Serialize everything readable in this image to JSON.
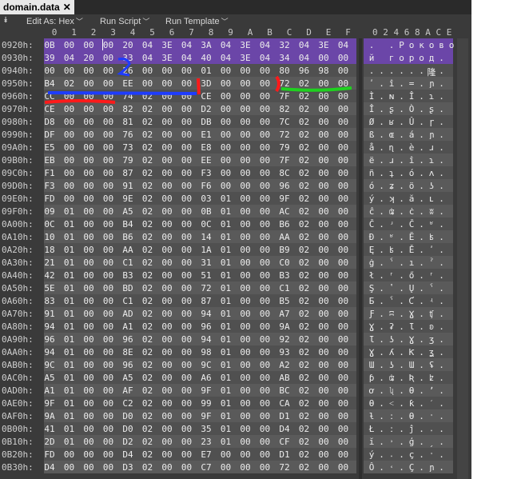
{
  "tab": {
    "title": "domain.data",
    "close": "✕"
  },
  "toolbar": {
    "edit_as": "Edit As: Hex",
    "run_script": "Run Script",
    "run_template": "Run Template"
  },
  "header": {
    "cols": [
      "0",
      "1",
      "2",
      "3",
      "4",
      "5",
      "6",
      "7",
      "8",
      "9",
      "A",
      "B",
      "C",
      "D",
      "E",
      "F"
    ],
    "ascii_cols": "0 2 4 6 8 A C E"
  },
  "rows": [
    {
      "addr": "0920h:",
      "bytes": [
        "0B",
        "00",
        "00",
        "00",
        "20",
        "04",
        "3E",
        "04",
        "3A",
        "04",
        "3E",
        "04",
        "32",
        "04",
        "3E",
        "04"
      ],
      "ascii": [
        ".",
        " ",
        ".",
        "Р",
        "о",
        "к",
        "о",
        "в",
        "о"
      ]
    },
    {
      "addr": "0930h:",
      "bytes": [
        "39",
        "04",
        "20",
        "00",
        "33",
        "04",
        "3E",
        "04",
        "40",
        "04",
        "3E",
        "04",
        "34",
        "04",
        "00",
        "00"
      ],
      "ascii": [
        "й",
        " ",
        "г",
        "о",
        "р",
        "о",
        "д",
        "."
      ]
    },
    {
      "addr": "0940h:",
      "bytes": [
        "00",
        "00",
        "00",
        "00",
        "26",
        "00",
        "00",
        "00",
        "01",
        "00",
        "00",
        "00",
        "80",
        "96",
        "98",
        "00"
      ],
      "ascii": [
        ".",
        ".",
        ".",
        ".",
        ".",
        ".",
        "隆",
        "."
      ]
    },
    {
      "addr": "0950h:",
      "bytes": [
        "B4",
        "02",
        "00",
        "00",
        "EE",
        "00",
        "00",
        "00",
        "3D",
        "00",
        "00",
        "00",
        "72",
        "02",
        "00",
        "00"
      ],
      "ascii": [
        "ʹ",
        ".",
        "î",
        ".",
        "=",
        ".",
        "ɲ",
        "."
      ]
    },
    {
      "addr": "0960h:",
      "bytes": [
        "CC",
        "00",
        "00",
        "00",
        "74",
        "02",
        "00",
        "00",
        "CE",
        "00",
        "00",
        "00",
        "7F",
        "02",
        "00",
        "00"
      ],
      "ascii": [
        "Ì",
        ".",
        "ɴ",
        ".",
        "Î",
        ".",
        "ɿ",
        "."
      ]
    },
    {
      "addr": "0970h:",
      "bytes": [
        "CE",
        "00",
        "00",
        "00",
        "82",
        "02",
        "00",
        "00",
        "D2",
        "00",
        "00",
        "00",
        "82",
        "02",
        "00",
        "00"
      ],
      "ascii": [
        "Î",
        ".",
        "ʂ",
        ".",
        "Ò",
        ".",
        "ʂ",
        "."
      ]
    },
    {
      "addr": "0980h:",
      "bytes": [
        "D8",
        "00",
        "00",
        "00",
        "81",
        "02",
        "00",
        "00",
        "DB",
        "00",
        "00",
        "00",
        "7C",
        "02",
        "00",
        "00"
      ],
      "ascii": [
        "Ø",
        ".",
        "ʁ",
        ".",
        "Û",
        ".",
        "ɼ",
        "."
      ]
    },
    {
      "addr": "0990h:",
      "bytes": [
        "DF",
        "00",
        "00",
        "00",
        "76",
        "02",
        "00",
        "00",
        "E1",
        "00",
        "00",
        "00",
        "72",
        "02",
        "00",
        "00"
      ],
      "ascii": [
        "ß",
        ".",
        "ɶ",
        ".",
        "á",
        ".",
        "ɲ",
        "."
      ]
    },
    {
      "addr": "09A0h:",
      "bytes": [
        "E5",
        "00",
        "00",
        "00",
        "73",
        "02",
        "00",
        "00",
        "E8",
        "00",
        "00",
        "00",
        "79",
        "02",
        "00",
        "00"
      ],
      "ascii": [
        "å",
        ".",
        "ɳ",
        ".",
        "è",
        ".",
        "ɹ",
        "."
      ]
    },
    {
      "addr": "09B0h:",
      "bytes": [
        "EB",
        "00",
        "00",
        "00",
        "79",
        "02",
        "00",
        "00",
        "EE",
        "00",
        "00",
        "00",
        "7F",
        "02",
        "00",
        "00"
      ],
      "ascii": [
        "ë",
        ".",
        "ɹ",
        ".",
        "î",
        ".",
        "ɿ",
        "."
      ]
    },
    {
      "addr": "09C0h:",
      "bytes": [
        "F1",
        "00",
        "00",
        "00",
        "87",
        "02",
        "00",
        "00",
        "F3",
        "00",
        "00",
        "00",
        "8C",
        "02",
        "00",
        "00"
      ],
      "ascii": [
        "ñ",
        ".",
        "ʇ",
        ".",
        "ó",
        ".",
        "ʌ",
        "."
      ]
    },
    {
      "addr": "09D0h:",
      "bytes": [
        "F3",
        "00",
        "00",
        "00",
        "91",
        "02",
        "00",
        "00",
        "F6",
        "00",
        "00",
        "00",
        "96",
        "02",
        "00",
        "00"
      ],
      "ascii": [
        "ó",
        ".",
        "ʑ",
        ".",
        "ö",
        ".",
        "ʖ",
        "."
      ]
    },
    {
      "addr": "09E0h:",
      "bytes": [
        "FD",
        "00",
        "00",
        "00",
        "9E",
        "02",
        "00",
        "00",
        "03",
        "01",
        "00",
        "00",
        "9F",
        "02",
        "00",
        "00"
      ],
      "ascii": [
        "ý",
        ".",
        "ʞ",
        ".",
        "ă",
        ".",
        "ʟ",
        "."
      ]
    },
    {
      "addr": "09F0h:",
      "bytes": [
        "09",
        "01",
        "00",
        "00",
        "A5",
        "02",
        "00",
        "00",
        "0B",
        "01",
        "00",
        "00",
        "AC",
        "02",
        "00",
        "00"
      ],
      "ascii": [
        "ĉ",
        ".",
        "ʥ",
        ".",
        "ċ",
        ".",
        "ʬ",
        "."
      ]
    },
    {
      "addr": "0A00h:",
      "bytes": [
        "0C",
        "01",
        "00",
        "00",
        "B4",
        "02",
        "00",
        "00",
        "0C",
        "01",
        "00",
        "00",
        "B6",
        "02",
        "00",
        "00"
      ],
      "ascii": [
        "Č",
        ".",
        "ʴ",
        ".",
        "Č",
        ".",
        "ʶ",
        "."
      ]
    },
    {
      "addr": "0A10h:",
      "bytes": [
        "10",
        "01",
        "00",
        "00",
        "B6",
        "02",
        "00",
        "00",
        "14",
        "01",
        "00",
        "00",
        "AA",
        "02",
        "00",
        "00"
      ],
      "ascii": [
        "Đ",
        ".",
        "ʶ",
        ".",
        "Ĕ",
        ".",
        "ʪ",
        "."
      ]
    },
    {
      "addr": "0A20h:",
      "bytes": [
        "18",
        "01",
        "00",
        "00",
        "AA",
        "02",
        "00",
        "00",
        "1A",
        "01",
        "00",
        "00",
        "B9",
        "02",
        "00",
        "00"
      ],
      "ascii": [
        "Ę",
        ".",
        "ʪ",
        ".",
        "Ě",
        ".",
        "ʹ",
        "."
      ]
    },
    {
      "addr": "0A30h:",
      "bytes": [
        "21",
        "01",
        "00",
        "00",
        "C1",
        "02",
        "00",
        "00",
        "31",
        "01",
        "00",
        "00",
        "C0",
        "02",
        "00",
        "00"
      ],
      "ascii": [
        "ġ",
        ".",
        "ˁ",
        ".",
        "ı",
        ".",
        "ˀ",
        "."
      ]
    },
    {
      "addr": "0A40h:",
      "bytes": [
        "42",
        "01",
        "00",
        "00",
        "B3",
        "02",
        "00",
        "00",
        "51",
        "01",
        "00",
        "00",
        "B3",
        "02",
        "00",
        "00"
      ],
      "ascii": [
        "ł",
        ".",
        "ʳ",
        ".",
        "ő",
        ".",
        "ʳ",
        "."
      ]
    },
    {
      "addr": "0A50h:",
      "bytes": [
        "5E",
        "01",
        "00",
        "00",
        "BD",
        "02",
        "00",
        "00",
        "72",
        "01",
        "00",
        "00",
        "C1",
        "02",
        "00",
        "00"
      ],
      "ascii": [
        "Ş",
        ".",
        "ʽ",
        ".",
        "Ų",
        ".",
        "ˁ",
        "."
      ]
    },
    {
      "addr": "0A60h:",
      "bytes": [
        "83",
        "01",
        "00",
        "00",
        "C1",
        "02",
        "00",
        "00",
        "87",
        "01",
        "00",
        "00",
        "B5",
        "02",
        "00",
        "00"
      ],
      "ascii": [
        "Ƃ",
        ".",
        "ˁ",
        ".",
        "Ƈ",
        ".",
        "ʵ",
        "."
      ]
    },
    {
      "addr": "0A70h:",
      "bytes": [
        "91",
        "01",
        "00",
        "00",
        "AD",
        "02",
        "00",
        "00",
        "94",
        "01",
        "00",
        "00",
        "A7",
        "02",
        "00",
        "00"
      ],
      "ascii": [
        "Ƒ",
        ".",
        "ʭ",
        ".",
        "Ɣ",
        ".",
        "ʧ",
        "."
      ]
    },
    {
      "addr": "0A80h:",
      "bytes": [
        "94",
        "01",
        "00",
        "00",
        "A1",
        "02",
        "00",
        "00",
        "96",
        "01",
        "00",
        "00",
        "9A",
        "02",
        "00",
        "00"
      ],
      "ascii": [
        "Ɣ",
        ".",
        "ʡ",
        ".",
        "Ɩ",
        ".",
        "ʚ",
        "."
      ]
    },
    {
      "addr": "0A90h:",
      "bytes": [
        "96",
        "01",
        "00",
        "00",
        "96",
        "02",
        "00",
        "00",
        "94",
        "01",
        "00",
        "00",
        "92",
        "02",
        "00",
        "00"
      ],
      "ascii": [
        "Ɩ",
        ".",
        "ʖ",
        ".",
        "Ɣ",
        ".",
        "ʒ",
        "."
      ]
    },
    {
      "addr": "0AA0h:",
      "bytes": [
        "94",
        "01",
        "00",
        "00",
        "8E",
        "02",
        "00",
        "00",
        "98",
        "01",
        "00",
        "00",
        "93",
        "02",
        "00",
        "00"
      ],
      "ascii": [
        "Ɣ",
        ".",
        "ʎ",
        ".",
        "Ƙ",
        ".",
        "ʓ",
        "."
      ]
    },
    {
      "addr": "0AB0h:",
      "bytes": [
        "9C",
        "01",
        "00",
        "00",
        "96",
        "02",
        "00",
        "00",
        "9C",
        "01",
        "00",
        "00",
        "A2",
        "02",
        "00",
        "00"
      ],
      "ascii": [
        "Ɯ",
        ".",
        "ʖ",
        ".",
        "Ɯ",
        ".",
        "ʢ",
        "."
      ]
    },
    {
      "addr": "0AC0h:",
      "bytes": [
        "A5",
        "01",
        "00",
        "00",
        "A5",
        "02",
        "00",
        "00",
        "A6",
        "01",
        "00",
        "00",
        "AB",
        "02",
        "00",
        "00"
      ],
      "ascii": [
        "ƥ",
        ".",
        "ʥ",
        ".",
        "Ʀ",
        ".",
        "ʫ",
        "."
      ]
    },
    {
      "addr": "0AD0h:",
      "bytes": [
        "A1",
        "01",
        "00",
        "00",
        "AF",
        "02",
        "00",
        "00",
        "9F",
        "01",
        "00",
        "00",
        "BC",
        "02",
        "00",
        "00"
      ],
      "ascii": [
        "ơ",
        ".",
        "ʯ",
        ".",
        "Ɵ",
        ".",
        "ʼ",
        "."
      ]
    },
    {
      "addr": "0AE0h:",
      "bytes": [
        "9F",
        "01",
        "00",
        "00",
        "C2",
        "02",
        "00",
        "00",
        "99",
        "01",
        "00",
        "00",
        "CA",
        "02",
        "00",
        "00"
      ],
      "ascii": [
        "Ɵ",
        ".",
        "˂",
        ".",
        "ƙ",
        ".",
        "ˊ",
        "."
      ]
    },
    {
      "addr": "0AF0h:",
      "bytes": [
        "9A",
        "01",
        "00",
        "00",
        "D0",
        "02",
        "00",
        "00",
        "9F",
        "01",
        "00",
        "00",
        "D1",
        "02",
        "00",
        "00"
      ],
      "ascii": [
        "ƚ",
        ".",
        "ː",
        ".",
        "Ɵ",
        ".",
        "ˑ",
        "."
      ]
    },
    {
      "addr": "0B00h:",
      "bytes": [
        "41",
        "01",
        "00",
        "00",
        "D0",
        "02",
        "00",
        "00",
        "35",
        "01",
        "00",
        "00",
        "D4",
        "02",
        "00",
        "00"
      ],
      "ascii": [
        "Ł",
        ".",
        "ː",
        ".",
        "ĵ",
        ".",
        "˔",
        "."
      ]
    },
    {
      "addr": "0B10h:",
      "bytes": [
        "2D",
        "01",
        "00",
        "00",
        "D2",
        "02",
        "00",
        "00",
        "23",
        "01",
        "00",
        "00",
        "CF",
        "02",
        "00",
        "00"
      ],
      "ascii": [
        "ĭ",
        ".",
        "˒",
        ".",
        "ģ",
        ".",
        "ˏ",
        "."
      ]
    },
    {
      "addr": "0B20h:",
      "bytes": [
        "FD",
        "00",
        "00",
        "00",
        "D4",
        "02",
        "00",
        "00",
        "E7",
        "00",
        "00",
        "00",
        "D1",
        "02",
        "00",
        "00"
      ],
      "ascii": [
        "ý",
        ".",
        "˔",
        ".",
        "ç",
        ".",
        "ˑ",
        "."
      ]
    },
    {
      "addr": "0B30h:",
      "bytes": [
        "D4",
        "00",
        "00",
        "00",
        "D3",
        "02",
        "00",
        "00",
        "C7",
        "00",
        "00",
        "00",
        "72",
        "02",
        "00",
        "00"
      ],
      "ascii": [
        "Ô",
        ".",
        "˓",
        ".",
        "Ç",
        ".",
        "ɲ",
        "."
      ]
    }
  ]
}
